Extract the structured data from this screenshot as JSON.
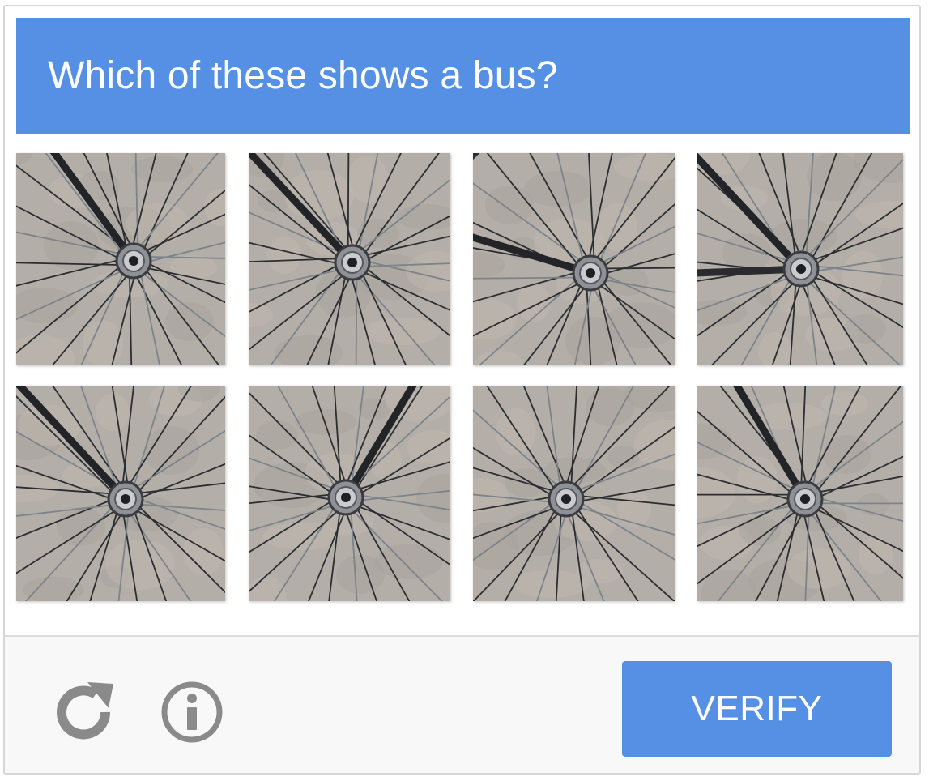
{
  "captcha": {
    "prompt": "Which of these shows a bus?",
    "tiles": [
      {
        "subject": "bicycle wheel hub"
      },
      {
        "subject": "bicycle wheel hub"
      },
      {
        "subject": "bicycle wheel hub"
      },
      {
        "subject": "bicycle wheel hub"
      },
      {
        "subject": "bicycle wheel hub"
      },
      {
        "subject": "bicycle wheel hub"
      },
      {
        "subject": "bicycle wheel hub"
      },
      {
        "subject": "bicycle wheel hub"
      }
    ],
    "footer": {
      "reload_icon": "reload-icon",
      "info_icon": "info-icon",
      "verify_label": "VERIFY"
    },
    "colors": {
      "accent": "#5590e4",
      "footer_bg": "#f8f8f8",
      "icon_gray": "#8a8a8a"
    }
  }
}
